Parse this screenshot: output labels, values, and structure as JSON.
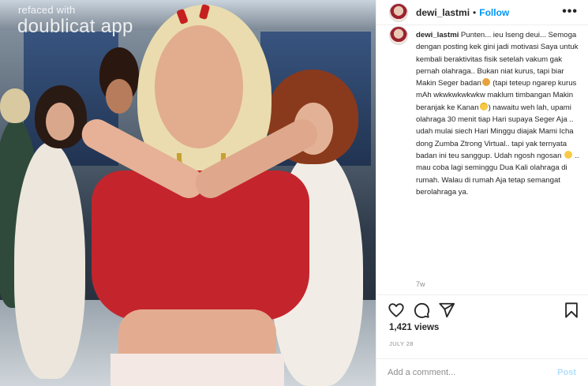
{
  "media": {
    "watermark_top": "refaced with",
    "watermark_bottom": "doublicat app"
  },
  "post": {
    "username": "dewi_lastmi",
    "separator": "•",
    "follow_label": "Follow",
    "more_label": "•••"
  },
  "caption": {
    "username": "dewi_lastmi",
    "segments": [
      "Punten... ieu Iseng deui... Semoga dengan posting kek gini jadi motivasi Saya untuk kembali beraktivitas fisik setelah vakum gak pernah olahraga.. Bukan niat kurus, tapi biar Makin Seger badan",
      " (tapi teteup ngarep kurus mAh wkwkwkwkwkw maklum timbangan Makin beranjak ke Kanan",
      ") nawaitu weh lah, upami olahraga 30 menit tiap Hari supaya Seger Aja .. udah mulai siech Hari Minggu diajak Mami Icha dong Zumba Ztrong Virtual.. tapi yak ternyata badan ini teu sanggup. Udah ngosh ngosan",
      " .. mau coba lagi seminggu Dua Kali olahraga di rumah. Walau di rumah Aja tetap semangat berolahraga ya."
    ],
    "time_ago": "7w"
  },
  "actions": {
    "icons": [
      "heart-icon",
      "comment-icon",
      "share-icon",
      "bookmark-icon"
    ]
  },
  "stats": {
    "views": "1,421 views",
    "date": "JULY 28"
  },
  "comment_box": {
    "placeholder": "Add a comment...",
    "post_label": "Post"
  },
  "colors": {
    "link_blue": "#0095f6",
    "post_disabled": "#b2dffc",
    "muted": "#8e8e8e",
    "text": "#262626"
  }
}
